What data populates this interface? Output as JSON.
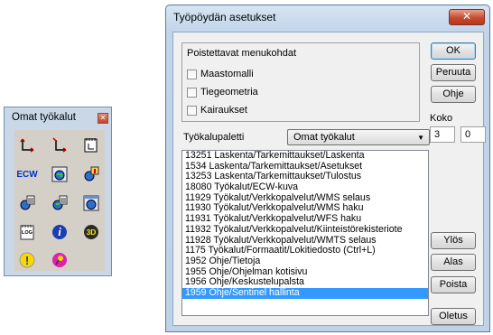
{
  "toolbox": {
    "title": "Omat työkalut",
    "close_glyph": "✕",
    "tools": [
      {
        "icon": "move-axis-icon"
      },
      {
        "icon": "move-axis-alt-icon"
      },
      {
        "icon": "calendar-axis-icon"
      },
      {
        "icon": "ecw-icon",
        "text": "ECW"
      },
      {
        "icon": "wms-globe-icon"
      },
      {
        "icon": "wms-download-icon"
      },
      {
        "icon": "wfs-icon"
      },
      {
        "icon": "wmts-icon"
      },
      {
        "icon": "globe-window-icon"
      },
      {
        "icon": "log-icon",
        "text": "LOG"
      },
      {
        "icon": "info-icon",
        "text": "i"
      },
      {
        "icon": "3d-icon",
        "text": "3D"
      },
      {
        "icon": "exclamation-icon",
        "text": "!"
      },
      {
        "icon": "pin-icon"
      }
    ]
  },
  "dialog": {
    "title": "Työpöydän asetukset",
    "close_glyph": "✕",
    "removable_group": {
      "title": "Poistettavat menukohdat",
      "items": [
        "Maastomalli",
        "Tiegeometria",
        "Kairaukset"
      ]
    },
    "buttons": {
      "ok": "OK",
      "cancel": "Peruuta",
      "help": "Ohje",
      "up": "Ylös",
      "down": "Alas",
      "remove": "Poista",
      "defaults": "Oletus"
    },
    "size": {
      "label": "Koko",
      "cols": "3",
      "rows": "0"
    },
    "palette": {
      "label": "Työkalupaletti",
      "selected": "Omat työkalut"
    },
    "list_items": [
      "13251 Laskenta/Tarkemittaukset/Laskenta",
      "1534 Laskenta/Tarkemittaukset/Asetukset",
      "13253 Laskenta/Tarkemittaukset/Tulostus",
      "18080 Työkalut/ECW-kuva",
      "11929 Työkalut/Verkkopalvelut/WMS selaus",
      "11930 Työkalut/Verkkopalvelut/WMS haku",
      "11931 Työkalut/Verkkopalvelut/WFS haku",
      "11932 Työkalut/Verkkopalvelut/Kiinteistörekisteriote",
      "11928 Työkalut/Verkkopalvelut/WMTS selaus",
      "1175 Työkalut/Formaatit/Lokitiedosto (Ctrl+L)",
      "1952 Ohje/Tietoja",
      "1955 Ohje/Ohjelman kotisivu",
      "1956 Ohje/Keskustelupalsta",
      "1959 Ohje/Sentinel hallinta"
    ],
    "selected_index": 13
  }
}
